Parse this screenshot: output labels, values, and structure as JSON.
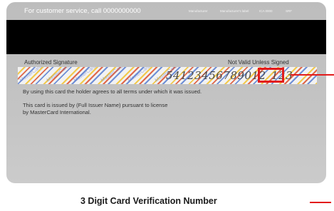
{
  "card": {
    "service_text": "For customer service, call 0000000000",
    "small_labels": [
      "Manufacturer",
      "Manufacturer's label",
      "ICA 0000",
      "SRF"
    ],
    "authorized_signature": "Authorized Signature",
    "not_valid": "Not Valid Unless Signed",
    "watermark": "MasterCard",
    "account_digits": "54123456789012",
    "cvv": "123",
    "terms_line": "By using this card the holder agrees to all terms under which it was issued.",
    "issuer_line_1": "This card is issued by (Full Issuer Name) pursuant to license",
    "issuer_line_2": "by MasterCard International."
  },
  "caption": "3 Digit Card Verification Number",
  "colors": {
    "highlight": "#e21c1c",
    "card_gray": "#c4c4c4",
    "stripe": "#000000"
  }
}
